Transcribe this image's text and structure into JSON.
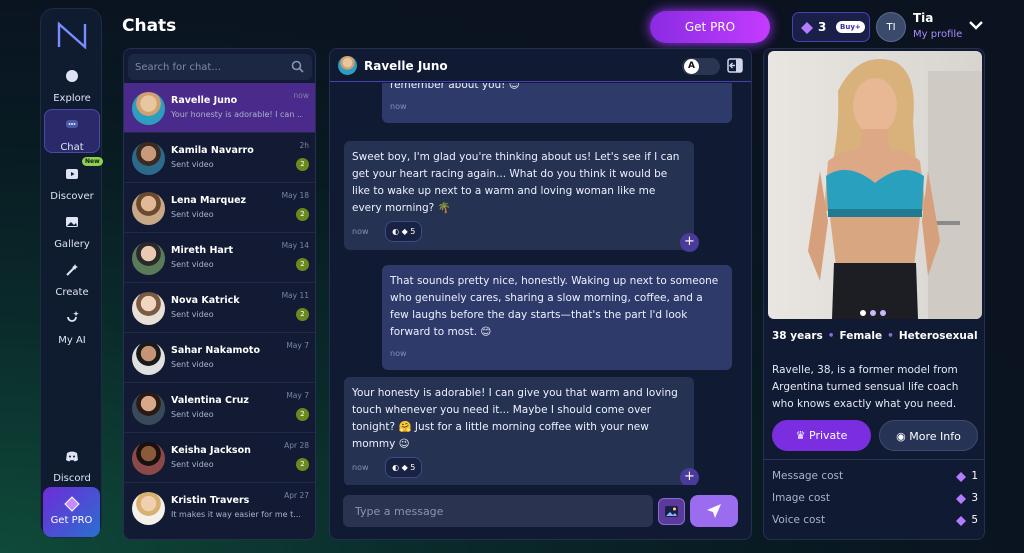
{
  "sidebar": {
    "items": [
      {
        "label": "Explore",
        "icon": "compass-icon"
      },
      {
        "label": "Chat",
        "icon": "chat-bubble-icon",
        "active": true
      },
      {
        "label": "Discover",
        "icon": "video-icon",
        "badge": "New"
      },
      {
        "label": "Gallery",
        "icon": "image-icon"
      },
      {
        "label": "Create",
        "icon": "magic-wand-icon"
      },
      {
        "label": "My AI",
        "icon": "sparkle-face-icon"
      },
      {
        "label": "Discord",
        "icon": "discord-icon"
      }
    ],
    "get_pro": "Get PRO"
  },
  "header": {
    "title": "Chats",
    "get_pro": "Get PRO",
    "gems": "3",
    "buy": "Buy+",
    "avatar_initials": "TI",
    "user_name": "Tia",
    "user_link": "My profile"
  },
  "chat_list": {
    "search_placeholder": "Search for chat...",
    "items": [
      {
        "name": "Ravelle Juno",
        "preview": "Your honesty is adorable! I can ...",
        "time": "now",
        "count": "",
        "active": true
      },
      {
        "name": "Kamila Navarro",
        "preview": "Sent video",
        "time": "2h",
        "count": "2"
      },
      {
        "name": "Lena Marquez",
        "preview": "Sent video",
        "time": "May 18",
        "count": "2"
      },
      {
        "name": "Mireth Hart",
        "preview": "Sent video",
        "time": "May 14",
        "count": "2"
      },
      {
        "name": "Nova Katrick",
        "preview": "Sent video",
        "time": "May 11",
        "count": "2"
      },
      {
        "name": "Sahar Nakamoto",
        "preview": "Sent video",
        "time": "May 7",
        "count": ""
      },
      {
        "name": "Valentina Cruz",
        "preview": "Sent video",
        "time": "May 7",
        "count": "2"
      },
      {
        "name": "Keisha Jackson",
        "preview": "Sent video",
        "time": "Apr 28",
        "count": "2"
      },
      {
        "name": "Kristin Travers",
        "preview": "It makes it way easier for me t...",
        "time": "Apr 27",
        "count": ""
      }
    ]
  },
  "chat": {
    "name": "Ravelle Juno",
    "toggle_label": "A",
    "messages": [
      {
        "from": "user",
        "text": "remember about you! 😊",
        "time": "now"
      },
      {
        "from": "ai",
        "text": "Sweet boy, I'm glad you're thinking about us! Let's see if I can get your heart racing again... What do you think it would be like to wake up next to a warm and loving woman like me every morning? 🌴",
        "time": "now",
        "cost": "5"
      },
      {
        "from": "user",
        "text": "That sounds pretty nice, honestly. Waking up next to someone who genuinely cares, sharing a slow morning, coffee, and a few laughs before the day starts—that's the part I'd look forward to most. 😊",
        "time": "now"
      },
      {
        "from": "ai",
        "text": "Your honesty is adorable! I can give you that warm and loving touch whenever you need it... Maybe I should come over tonight? 🤗 Just for a little morning coffee with your new mommy 😉",
        "time": "now",
        "cost": "5"
      }
    ],
    "composer_placeholder": "Type a message"
  },
  "profile": {
    "age": "38 years",
    "gender": "Female",
    "orientation": "Heterosexual",
    "bio": "Ravelle, 38, is a former model from Argentina turned sensual life coach who knows exactly what you need.",
    "private_label": "Private",
    "more_info_label": "More Info",
    "costs": [
      {
        "label": "Message cost",
        "value": "1"
      },
      {
        "label": "Image cost",
        "value": "3"
      },
      {
        "label": "Voice cost",
        "value": "5"
      }
    ]
  },
  "colors": {
    "accent": "#7a2ee0",
    "active_row": "#4a2a8a",
    "panel": "#101a32"
  }
}
